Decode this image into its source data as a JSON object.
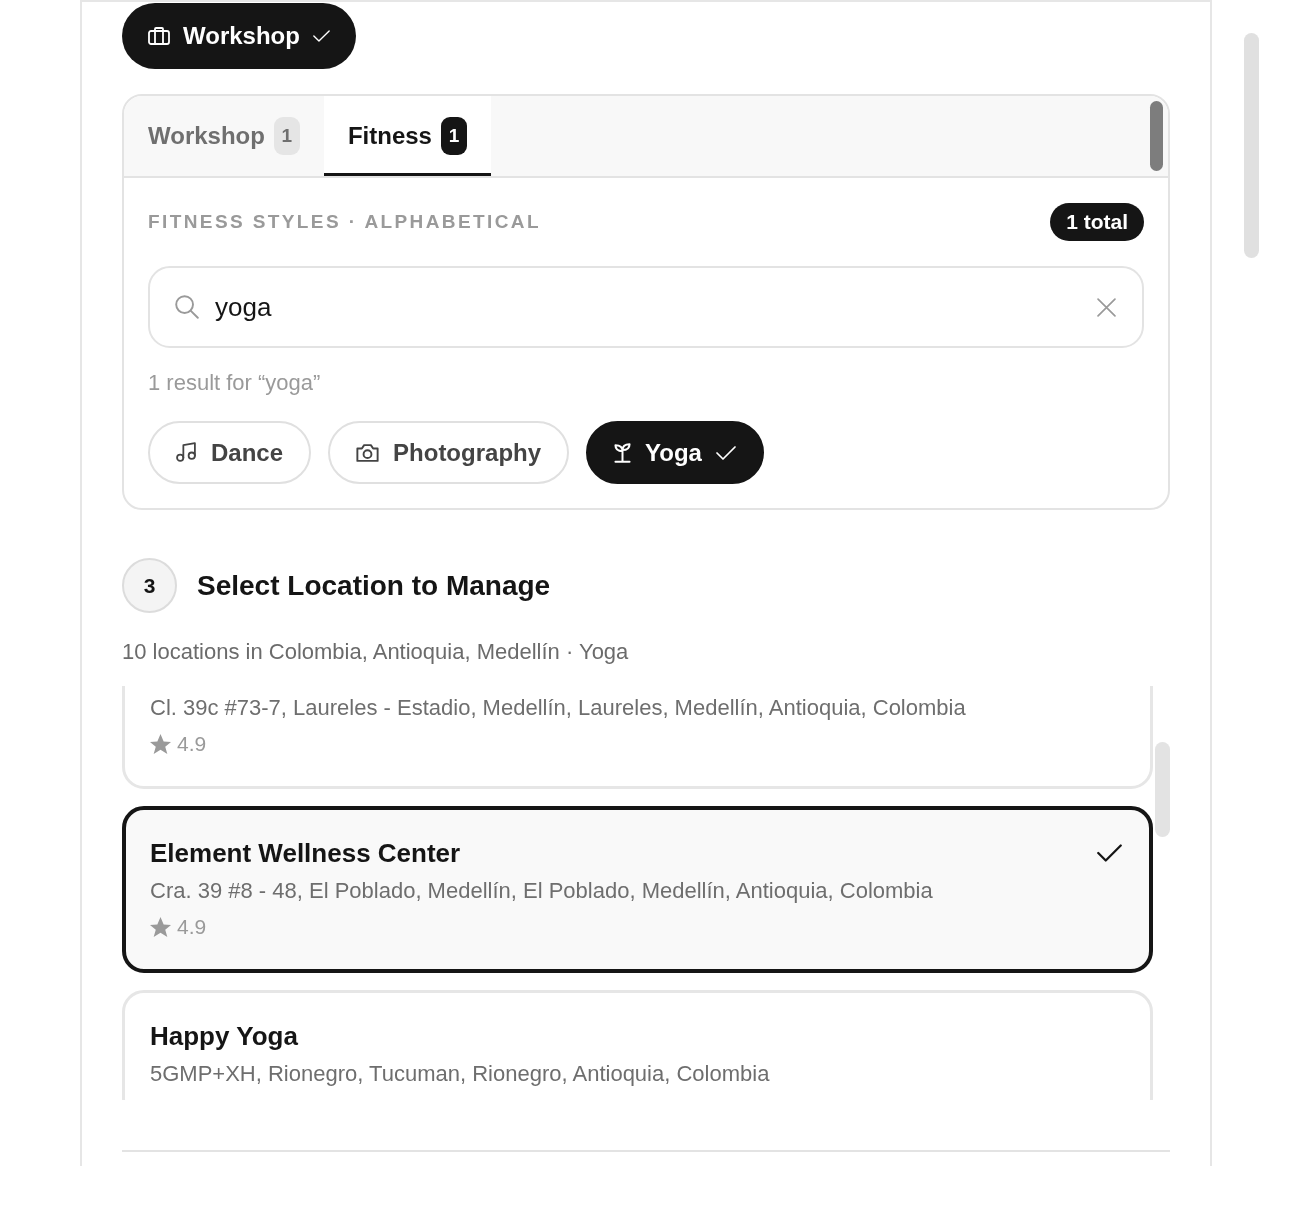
{
  "top_button": {
    "label": "Workshop",
    "selected": true
  },
  "tabs": [
    {
      "label": "Workshop",
      "count": "1",
      "selected": false
    },
    {
      "label": "Fitness",
      "count": "1",
      "selected": true
    }
  ],
  "styles_panel": {
    "heading": "FITNESS STYLES · ALPHABETICAL",
    "total": "1 total",
    "search": {
      "value": "yoga"
    },
    "result_text": "1 result for “yoga”",
    "chips": [
      {
        "label": "Dance",
        "selected": false
      },
      {
        "label": "Photography",
        "selected": false
      },
      {
        "label": "Yoga",
        "selected": true
      }
    ]
  },
  "step": {
    "number": "3",
    "title": "Select Location to Manage",
    "subtitle": "10 locations in Colombia, Antioquia, Medellín · Yoga"
  },
  "locations": [
    {
      "address": "Cl. 39c #73-7, Laureles - Estadio, Medellín, Laureles, Medellín, Antioquia, Colombia",
      "rating": "4.9",
      "selected": false
    },
    {
      "name": "Element Wellness Center",
      "address": "Cra. 39 #8 - 48, El Poblado, Medellín, El Poblado, Medellín, Antioquia, Colombia",
      "rating": "4.9",
      "selected": true
    },
    {
      "name": "Happy Yoga",
      "address": "5GMP+XH, Rionegro, Tucuman, Rionegro, Antioquia, Colombia",
      "selected": false
    }
  ]
}
